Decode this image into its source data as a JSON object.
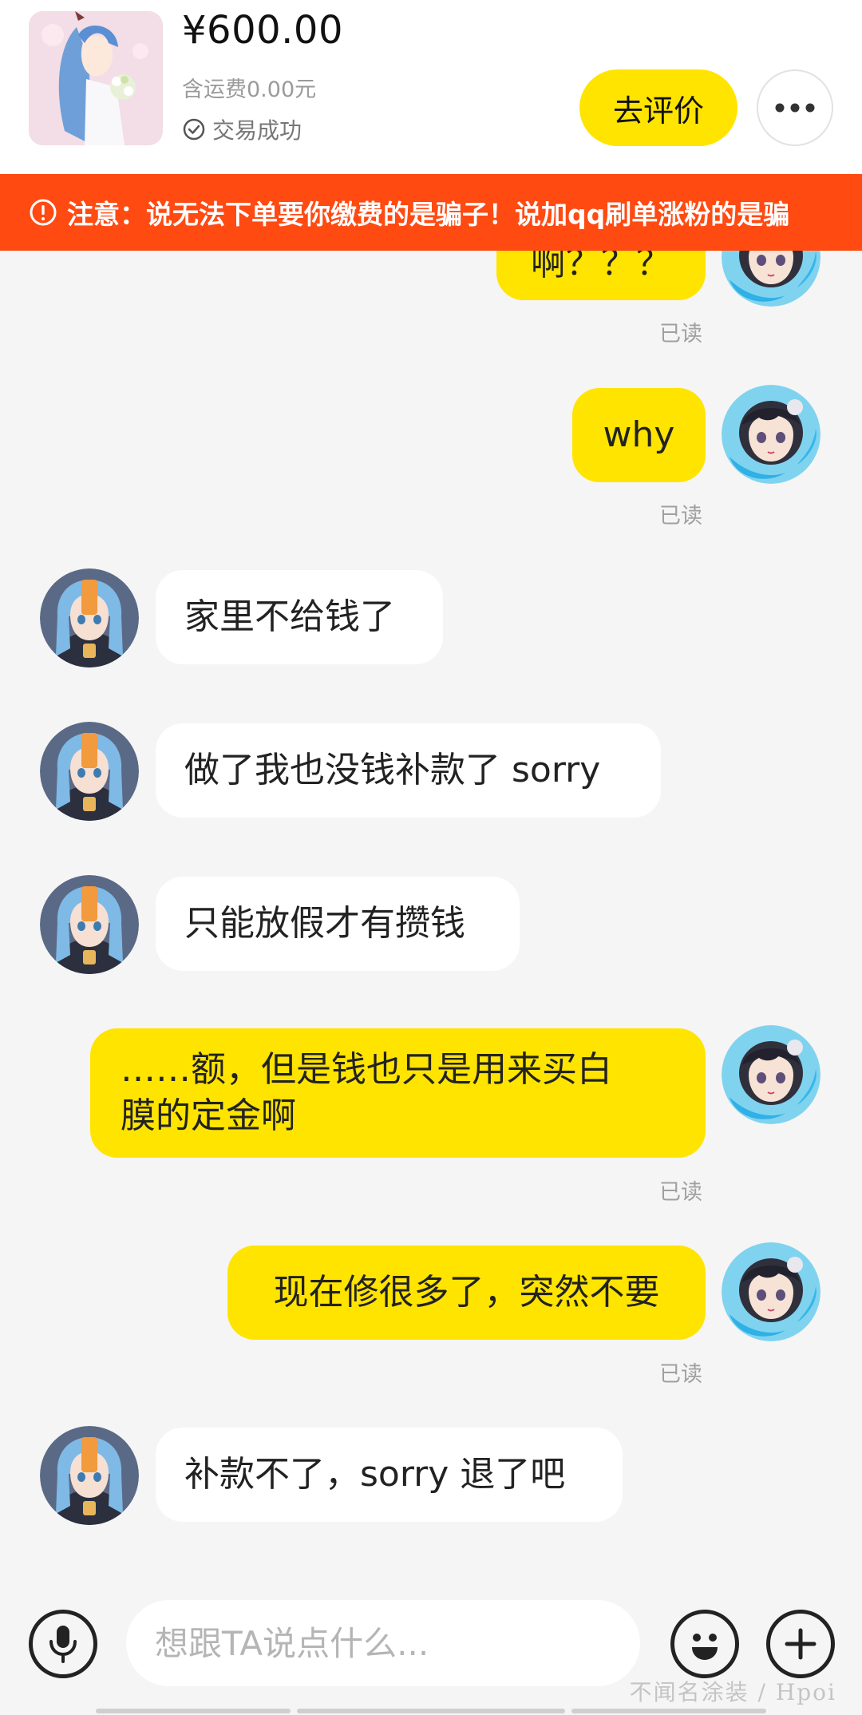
{
  "order": {
    "price": "¥600.00",
    "shipping": "含运费0.00元",
    "status": "交易成功",
    "review_button": "去评价",
    "more_icon": "more-horizontal-icon"
  },
  "banner": {
    "icon": "warning-icon",
    "text": "注意：说无法下单要你缴费的是骗子！说加qq刷单涨粉的是骗"
  },
  "messages": [
    {
      "from": "me",
      "text": "啊？？？",
      "read": "已读"
    },
    {
      "from": "me",
      "text": "why",
      "read": "已读"
    },
    {
      "from": "them",
      "text": "家里不给钱了"
    },
    {
      "from": "them",
      "text": "做了我也没钱补款了 sorry"
    },
    {
      "from": "them",
      "text": "只能放假才有攒钱"
    },
    {
      "from": "me",
      "lines": [
        "……额，但是钱也只是用来买白",
        "膜的定金啊"
      ],
      "read": "已读"
    },
    {
      "from": "me",
      "text": "现在修很多了，突然不要",
      "read": "已读"
    },
    {
      "from": "them",
      "text": "补款不了，sorry 退了吧"
    }
  ],
  "input": {
    "placeholder": "想跟TA说点什么...",
    "value": ""
  },
  "icons": {
    "mic": "microphone-icon",
    "emoji": "emoji-icon",
    "plus": "plus-icon"
  },
  "watermark": "不闻名涂装 / Hpoi",
  "colors": {
    "accent": "#ffe400",
    "banner": "#ff4a12",
    "background": "#f5f5f5"
  }
}
